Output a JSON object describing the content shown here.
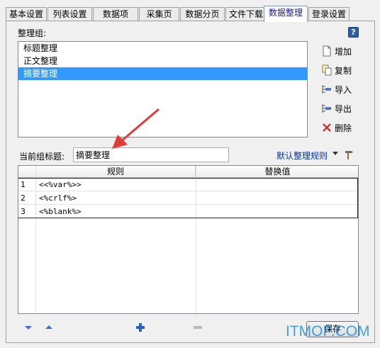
{
  "tabs": [
    {
      "label": "基本设置",
      "active": false
    },
    {
      "label": "列表设置",
      "active": false
    },
    {
      "label": "数据项",
      "active": false
    },
    {
      "label": "采集页",
      "active": false
    },
    {
      "label": "数据分页",
      "active": false
    },
    {
      "label": "文件下载",
      "active": false
    },
    {
      "label": "数据整理",
      "active": true
    },
    {
      "label": "登录设置",
      "active": false
    }
  ],
  "group_label": "整理组:",
  "groups": [
    "标题整理",
    "正文整理",
    "摘要整理"
  ],
  "selected_group": 2,
  "side_buttons": {
    "add": "增加",
    "copy": "复制",
    "import": "导入",
    "export": "导出",
    "delete": "删除"
  },
  "current_title_label": "当前组标题:",
  "current_title_value": "摘要整理",
  "default_rules_link": "默认整理规则",
  "grid": {
    "headers": [
      "规则",
      "替换值"
    ],
    "rows": [
      {
        "num": "1",
        "rule": "<<%var%>>",
        "replace": ""
      },
      {
        "num": "2",
        "rule": "<%crlf%>",
        "replace": ""
      },
      {
        "num": "3",
        "rule": "<%blank%>",
        "replace": ""
      }
    ]
  },
  "save_label": "保存",
  "watermark": "ITMOP.COM",
  "colors": {
    "selection": "#3399ff",
    "link": "#003399",
    "arrow": "#e03a3a"
  }
}
